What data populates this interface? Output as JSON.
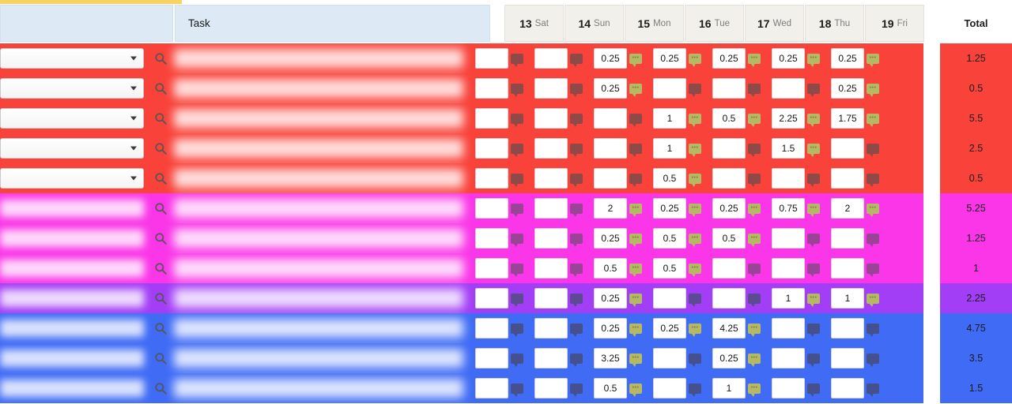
{
  "progress": {
    "percent": 18
  },
  "header": {
    "task_label": "Task",
    "total_label": "Total",
    "days": [
      {
        "num": "13",
        "dow": "Sat"
      },
      {
        "num": "14",
        "dow": "Sun"
      },
      {
        "num": "15",
        "dow": "Mon"
      },
      {
        "num": "16",
        "dow": "Tue"
      },
      {
        "num": "17",
        "dow": "Wed"
      },
      {
        "num": "18",
        "dow": "Thu"
      },
      {
        "num": "19",
        "dow": "Fri"
      }
    ]
  },
  "icons": {
    "search": "search-icon",
    "comment": "comment-bubble-icon",
    "caret": "chevron-down-icon"
  },
  "colors": {
    "band_red": "#f94239",
    "band_magenta": "#fa36e8",
    "band_purple": "#a23ef5",
    "band_blue": "#3f6bf5",
    "header_task": "#ddeaf5",
    "header_day": "#f2f0ea",
    "progress": "#fbd25f",
    "comment_filled": "#b5b964"
  },
  "rows": [
    {
      "band": "red",
      "left_kind": "select",
      "values": [
        "",
        "",
        "0.25",
        "0.25",
        "0.25",
        "0.25",
        "0.25"
      ],
      "total": "1.25"
    },
    {
      "band": "red",
      "left_kind": "select",
      "values": [
        "",
        "",
        "0.25",
        "",
        "",
        "",
        "0.25"
      ],
      "total": "0.5"
    },
    {
      "band": "red",
      "left_kind": "select",
      "values": [
        "",
        "",
        "",
        "1",
        "0.5",
        "2.25",
        "1.75"
      ],
      "total": "5.5"
    },
    {
      "band": "red",
      "left_kind": "select",
      "values": [
        "",
        "",
        "",
        "1",
        "",
        "1.5",
        ""
      ],
      "total": "2.5"
    },
    {
      "band": "red",
      "left_kind": "select",
      "values": [
        "",
        "",
        "",
        "0.5",
        "",
        "",
        ""
      ],
      "total": "0.5"
    },
    {
      "band": "mag",
      "left_kind": "blur",
      "values": [
        "",
        "",
        "2",
        "0.25",
        "0.25",
        "0.75",
        "2"
      ],
      "total": "5.25"
    },
    {
      "band": "mag",
      "left_kind": "blur",
      "values": [
        "",
        "",
        "0.25",
        "0.5",
        "0.5",
        "",
        ""
      ],
      "total": "1.25"
    },
    {
      "band": "mag",
      "left_kind": "blur",
      "values": [
        "",
        "",
        "0.5",
        "0.5",
        "",
        "",
        ""
      ],
      "total": "1"
    },
    {
      "band": "pur",
      "left_kind": "blur",
      "values": [
        "",
        "",
        "0.25",
        "",
        "",
        "1",
        "1"
      ],
      "total": "2.25"
    },
    {
      "band": "blue",
      "left_kind": "blur",
      "values": [
        "",
        "",
        "0.25",
        "0.25",
        "4.25",
        "",
        ""
      ],
      "total": "4.75"
    },
    {
      "band": "blue",
      "left_kind": "blur",
      "values": [
        "",
        "",
        "3.25",
        "",
        "0.25",
        "",
        ""
      ],
      "total": "3.5"
    },
    {
      "band": "blue",
      "left_kind": "blur",
      "values": [
        "",
        "",
        "0.5",
        "",
        "1",
        "",
        ""
      ],
      "total": "1.5"
    }
  ]
}
